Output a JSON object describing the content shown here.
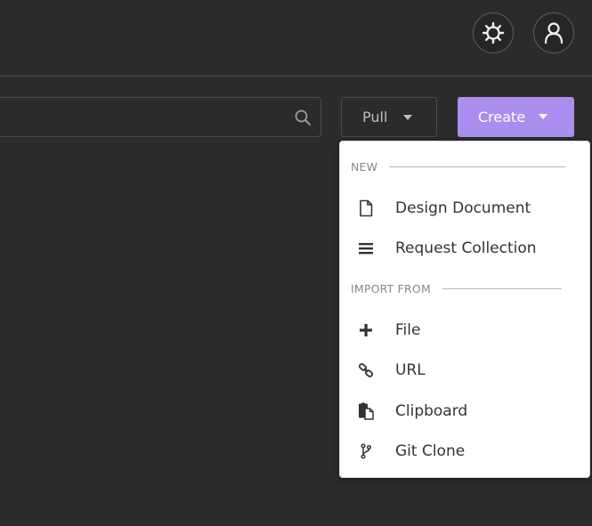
{
  "header": {
    "settings_icon": "gear-icon",
    "account_icon": "user-icon"
  },
  "toolbar": {
    "search": {
      "value": "",
      "icon": "search-icon"
    },
    "pull_label": "Pull",
    "create_label": "Create"
  },
  "dropdown": {
    "section_new": "NEW",
    "new_items": [
      {
        "label": "Design Document",
        "icon": "document-icon"
      },
      {
        "label": "Request Collection",
        "icon": "list-icon"
      }
    ],
    "section_import": "IMPORT FROM",
    "import_items": [
      {
        "label": "File",
        "icon": "plus-icon"
      },
      {
        "label": "URL",
        "icon": "link-icon"
      },
      {
        "label": "Clipboard",
        "icon": "clipboard-icon"
      },
      {
        "label": "Git Clone",
        "icon": "git-branch-icon"
      }
    ]
  },
  "colors": {
    "background": "#2b2b2b",
    "accent": "#a98ef0",
    "dropdown_bg": "#ffffff",
    "text_dark": "#333333",
    "section_text": "#888888"
  }
}
